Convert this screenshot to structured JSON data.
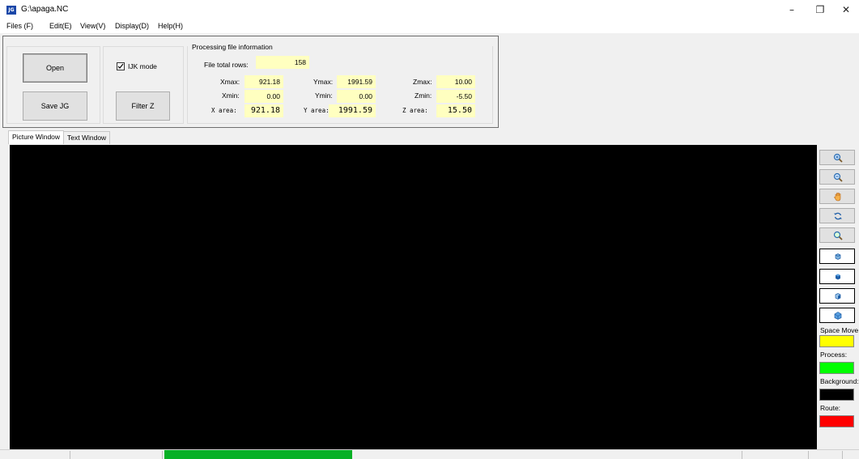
{
  "window": {
    "title": "G:\\apaga.NC",
    "app_icon_text": "JG",
    "minimize_glyph": "–",
    "maximize_glyph": "❐",
    "close_glyph": "✕"
  },
  "menu": [
    "Files (F)",
    "Edit(E)",
    "View(V)",
    "Display(D)",
    "Help(H)"
  ],
  "buttons": {
    "open": "Open",
    "save": "Save JG",
    "filter_z": "Filter Z"
  },
  "ijk_mode": {
    "label": "IJK mode",
    "checked": true
  },
  "info": {
    "group_title": "Processing file information",
    "total_rows_label": "File total rows:",
    "total_rows": "158",
    "xmax_label": "Xmax:",
    "xmax": "921.18",
    "ymax_label": "Ymax:",
    "ymax": "1991.59",
    "zmax_label": "Zmax:",
    "zmax": "10.00",
    "xmin_label": "Xmin:",
    "xmin": "0.00",
    "ymin_label": "Ymin:",
    "ymin": "0.00",
    "zmin_label": "Zmin:",
    "zmin": "-5.50",
    "xarea_label": "X area:",
    "xarea": "921.18",
    "yarea_label": "Y area:",
    "yarea": "1991.59",
    "zarea_label": "Z area:",
    "zarea": "15.50"
  },
  "tabs": [
    "Picture Window",
    "Text Window"
  ],
  "active_tab": 0,
  "side_tools": [
    "zoom-in-icon",
    "zoom-out-icon",
    "pan-hand-icon",
    "rotate-icon",
    "zoom-fit-icon",
    "view-front-icon",
    "view-top-icon",
    "view-side-icon",
    "view-iso-icon"
  ],
  "legend": [
    {
      "label": "Space Move",
      "color": "#ffff00"
    },
    {
      "label": "Process:",
      "color": "#00ff00"
    },
    {
      "label": "Background:",
      "color": "#000000"
    },
    {
      "label": "Route:",
      "color": "#ff0000"
    }
  ],
  "status": {
    "progress_color": "#06b025"
  }
}
